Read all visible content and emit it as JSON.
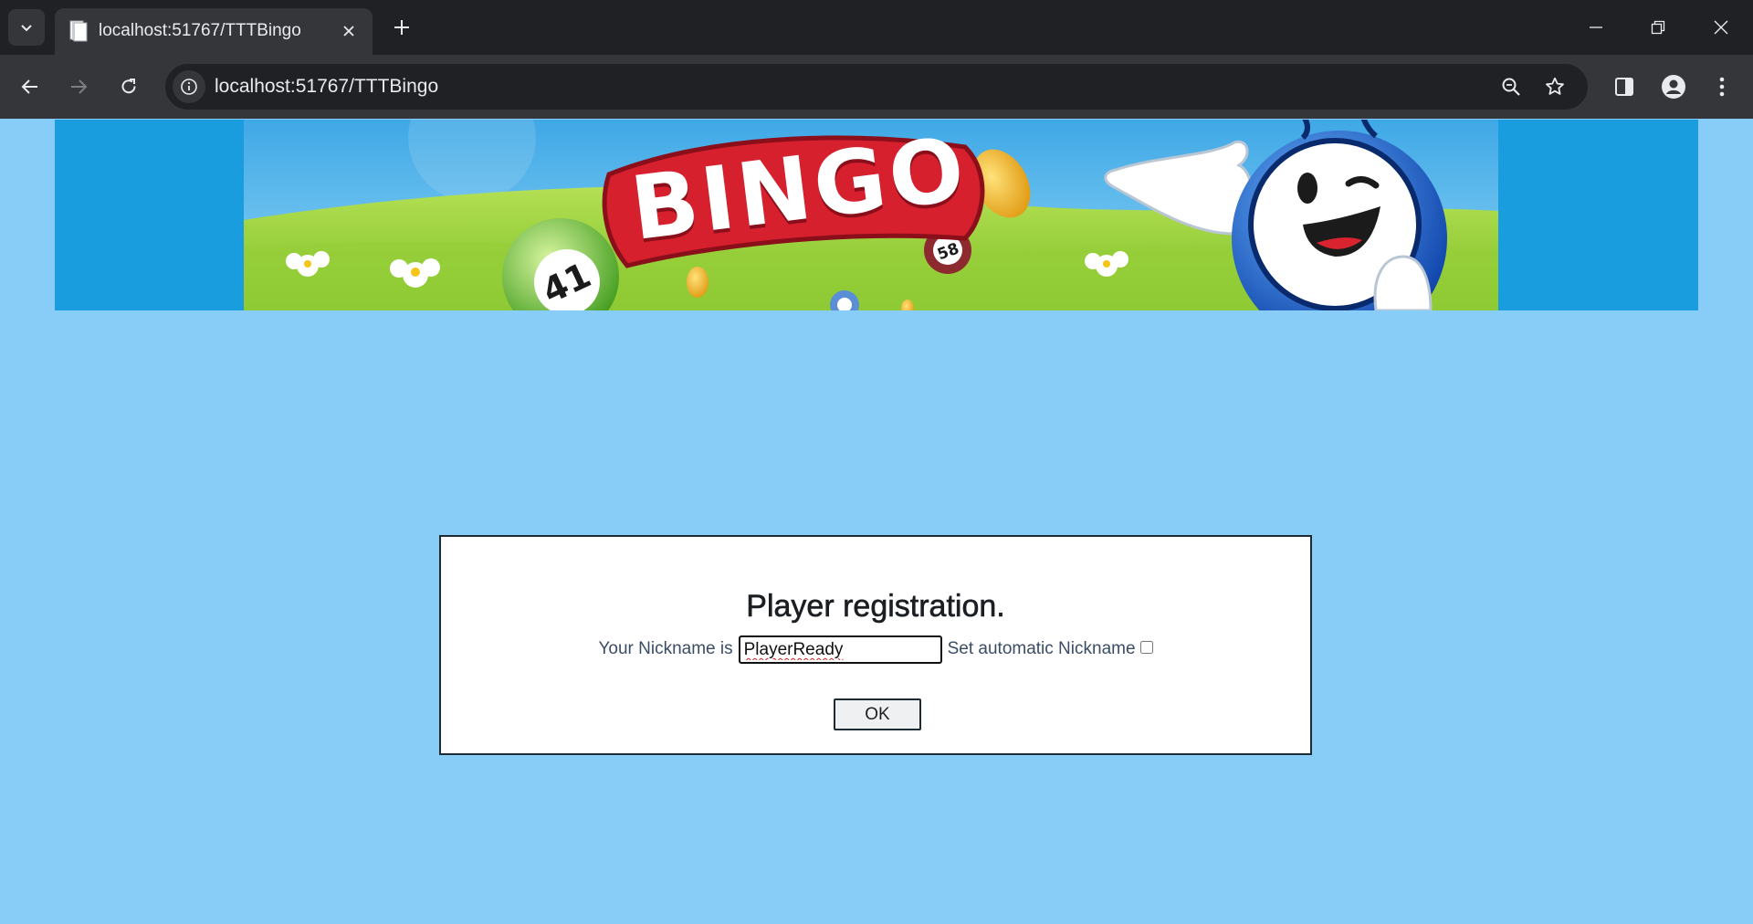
{
  "browser": {
    "tab": {
      "title": "localhost:51767/TTTBingo"
    },
    "address_bar": {
      "url": "localhost:51767/TTTBingo"
    }
  },
  "banner": {
    "logo_text": "BINGO",
    "ball_numbers": [
      "41",
      "58"
    ]
  },
  "registration": {
    "title": "Player registration.",
    "nickname_label": "Your Nickname is",
    "nickname_value": "PlayerReady",
    "auto_nickname_label": "Set automatic Nickname",
    "auto_nickname_checked": false,
    "ok_label": "OK"
  },
  "colors": {
    "page_background": "#87cdf7",
    "banner_sky": "#1a9ddf",
    "banner_logo_red": "#d6202e",
    "label_text": "#3b4d66"
  }
}
